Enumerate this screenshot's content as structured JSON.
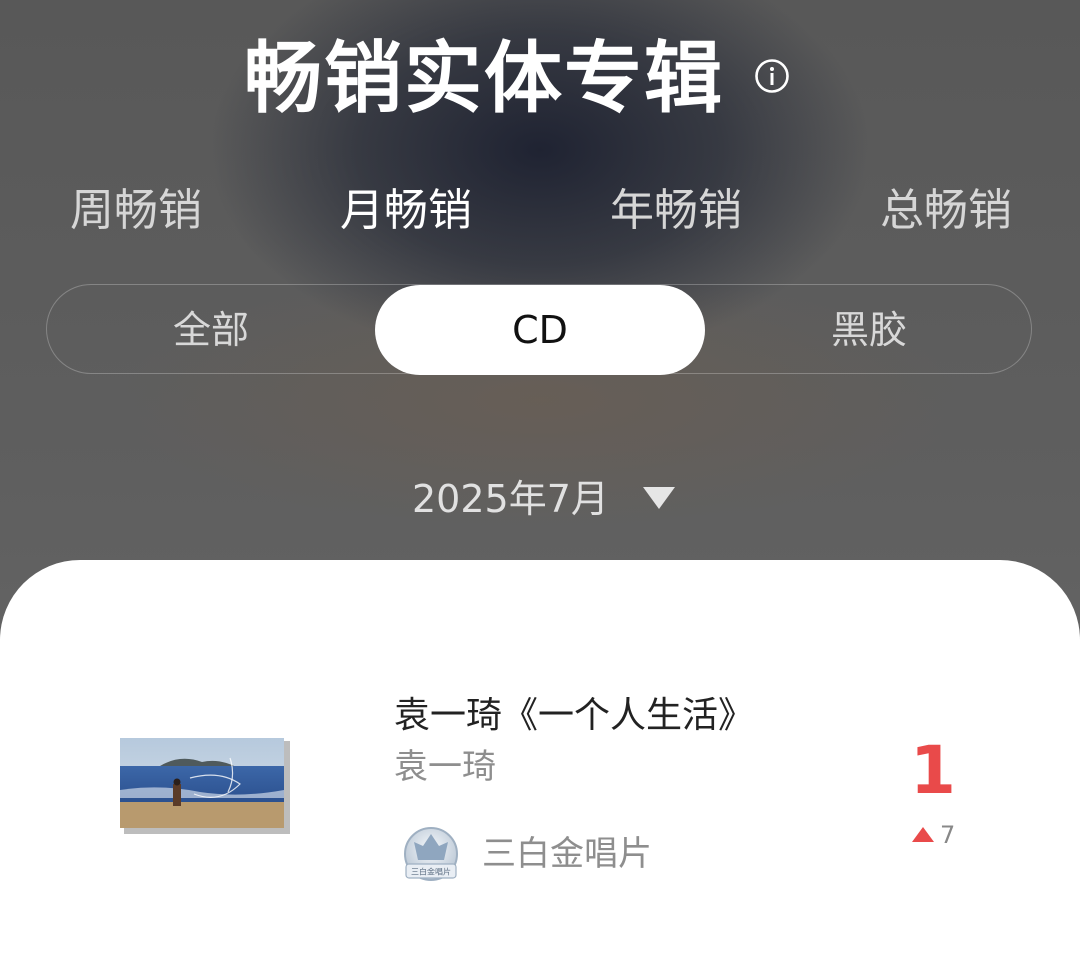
{
  "header": {
    "title": "畅销实体专辑",
    "info_icon": "info-icon"
  },
  "period_tabs": [
    {
      "label": "周畅销",
      "active": false
    },
    {
      "label": "月畅销",
      "active": true
    },
    {
      "label": "年畅销",
      "active": false
    },
    {
      "label": "总畅销",
      "active": false
    }
  ],
  "format_tabs": [
    {
      "label": "全部",
      "active": false
    },
    {
      "label": "CD",
      "active": true
    },
    {
      "label": "黑胶",
      "active": false
    }
  ],
  "date_picker": {
    "label": "2025年7月",
    "icon": "caret-down-icon"
  },
  "chart_entries": [
    {
      "title": "袁一琦《一个人生活》",
      "artist": "袁一琦",
      "certification": "三白金唱片",
      "certification_badge_text": "三白金唱片",
      "rank": "1",
      "rank_change": "7",
      "rank_change_direction": "up"
    }
  ],
  "colors": {
    "accent_red": "#e94a4a",
    "active_segment_bg": "#ffffff",
    "card_bg": "#ffffff"
  }
}
